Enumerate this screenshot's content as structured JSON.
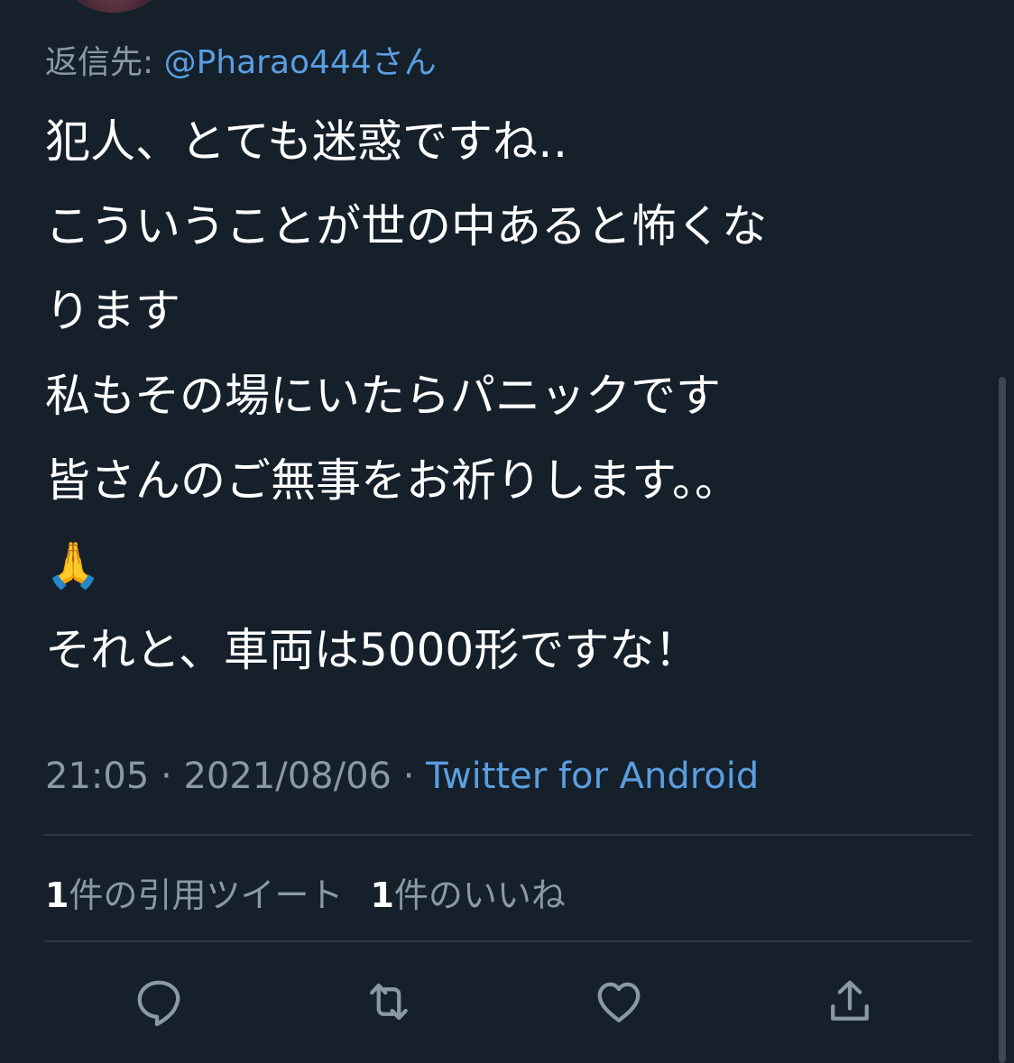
{
  "reply": {
    "prefix": "返信先: ",
    "handle": "@Pharao444さん"
  },
  "tweet": {
    "lines": [
      "犯人、とても迷惑ですね‥",
      "こういうことが世の中あると怖くな",
      "ります",
      "私もその場にいたらパニックです",
      "皆さんのご無事をお祈りします。。",
      "🙏",
      "それと、車両は5000形ですな！"
    ]
  },
  "meta": {
    "time": "21:05",
    "sep1": " · ",
    "date": "2021/08/06",
    "sep2": " · ",
    "source": "Twitter for Android"
  },
  "stats": {
    "quotes_count": "1",
    "quotes_label": "件の引用ツイート",
    "likes_count": "1",
    "likes_label": "件のいいね"
  },
  "actions": {
    "icons": [
      "reply-icon",
      "retweet-icon",
      "like-icon",
      "share-icon"
    ],
    "icon_color": "#8b98a5"
  },
  "colors": {
    "background": "#15202b",
    "text": "#ffffff",
    "secondary": "#8b98a5",
    "link": "#5b9ee0"
  }
}
